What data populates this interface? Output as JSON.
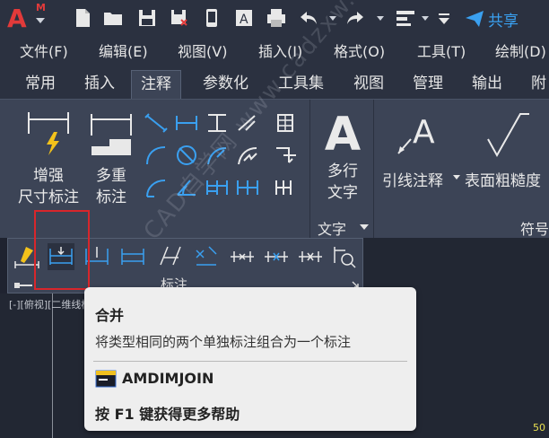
{
  "qat": {
    "logo": "A",
    "logo_sup": "M",
    "share_label": "共享"
  },
  "menubar": {
    "items": [
      "文件(F)",
      "编辑(E)",
      "视图(V)",
      "插入(I)",
      "格式(O)",
      "工具(T)",
      "绘制(D)"
    ]
  },
  "tabs": {
    "items": [
      "常用",
      "插入",
      "注释",
      "参数化",
      "工具集",
      "视图",
      "管理",
      "输出",
      "附"
    ],
    "active": "注释"
  },
  "panel": {
    "enhanced_dim": [
      "增强",
      "尺寸标注"
    ],
    "multi_dim": [
      "多重",
      "标注"
    ],
    "mtext": [
      "多行",
      "文字"
    ],
    "text_section": "文字",
    "leader": "引线注释",
    "surface": "表面粗糙度",
    "symbol_section": "符号",
    "dim_section": "标注"
  },
  "tooltip": {
    "title": "合并",
    "description": "将类型相同的两个单独标注组合为一个标注",
    "command": "AMDIMJOIN",
    "help": "按 F1 键获得更多帮助"
  },
  "viewport": {
    "label": "[-][俯视][二维线框]"
  },
  "statusbar": {
    "coord": "50"
  },
  "watermark": {
    "text": "CAD自学网 www.cadzxw.com"
  },
  "colors": {
    "accent_red": "#d8262b",
    "share_blue": "#3aa0f0",
    "panel_bg": "#3c4456"
  }
}
